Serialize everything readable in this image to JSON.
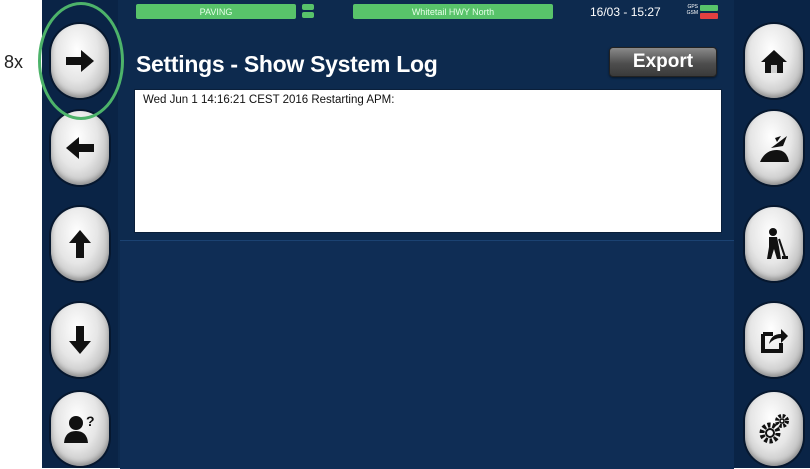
{
  "annotation": {
    "label": "8x"
  },
  "header": {
    "mode": "PAVING",
    "project": "Whitetail HWY North",
    "datetime": "16/03 - 15:27",
    "gps_label": "GPS",
    "gsm_label": "GSM",
    "gps_color": "#58c36a",
    "gsm_color": "#e04040",
    "status_color": "#58c36a"
  },
  "page": {
    "title": "Settings  -  Show System Log",
    "export_label": "Export"
  },
  "log": {
    "lines": [
      "Wed Jun 1 14:16:21 CEST 2016  Restarting APM:"
    ]
  },
  "left_nav": [
    {
      "icon": "arrow-right-icon"
    },
    {
      "icon": "arrow-left-icon"
    },
    {
      "icon": "arrow-up-icon"
    },
    {
      "icon": "arrow-down-icon"
    },
    {
      "icon": "user-help-icon"
    }
  ],
  "right_nav": [
    {
      "icon": "home-icon"
    },
    {
      "icon": "paving-icon"
    },
    {
      "icon": "worker-icon"
    },
    {
      "icon": "export-share-icon"
    },
    {
      "icon": "settings-gears-icon"
    }
  ],
  "colors": {
    "background": "#0d2a4e",
    "accent_green": "#58c36a",
    "accent_red": "#e04040"
  }
}
